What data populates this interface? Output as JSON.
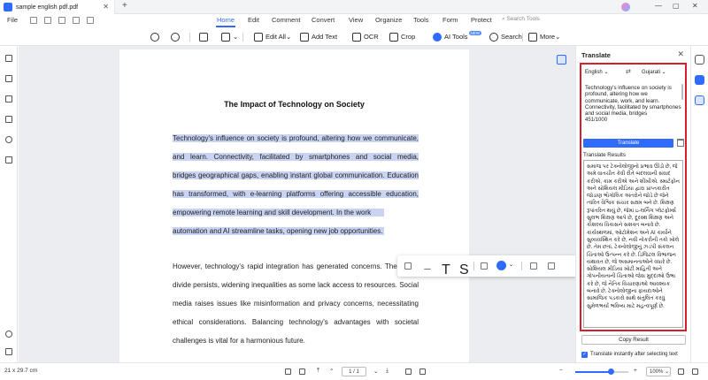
{
  "window": {
    "tab_title": "sample english pdf.pdf",
    "tab_close": "✕",
    "new_tab": "+",
    "minimize": "—",
    "maximize": "▢",
    "close": "✕"
  },
  "menu": {
    "file": "File",
    "items": [
      "Home",
      "Edit",
      "Comment",
      "Convert",
      "View",
      "Organize",
      "Tools",
      "Form",
      "Protect"
    ],
    "active": "Home",
    "search_tools": "Search Tools"
  },
  "toolbar": {
    "edit_all": "Edit All",
    "add_text": "Add Text",
    "ocr": "OCR",
    "crop": "Crop",
    "ai_tools": "AI Tools",
    "ai_badge": "NEW",
    "search": "Search",
    "more": "More"
  },
  "document": {
    "title": "The Impact of Technology on Society",
    "highlighted_lines": [
      "Technology's influence on society is profound, altering how we communicate,",
      "and learn. Connectivity, facilitated by smartphones and social media,",
      "bridges geographical gaps, enabling instant global communication. Education",
      "has transformed, with e-learning platforms offering accessible education,",
      "empowering remote learning and skill development. In the work",
      "automation and AI streamline tasks, opening new job opportunities."
    ],
    "para2_lines": [
      "However, technology's rapid integration has generated concerns. The digital",
      "divide persists, widening inequalities as some lack access to resources. Social",
      "media raises issues like misinformation and privacy concerns, necessitating",
      "ethical considerations. Balancing technology's advantages with societal",
      "challenges is vital for a harmonious future."
    ]
  },
  "translate_panel": {
    "title": "Translate",
    "close": "✕",
    "source_lang": "English",
    "target_lang": "Gujarati",
    "swap": "⇄",
    "source_text": "Technology's influence on society is profound, altering how we communicate, work, and learn. Connectivity, facilitated by smartphones and social media, bridges",
    "char_count": "451/1000",
    "translate_button": "Translate",
    "results_label": "Translate Results",
    "result_text": "સમાજ પર ટેક્નોલોજીનો પ્રભાવ ઊંડો છે, જે અમે વાતચીત કેવી રીતે બદલવાની સંવાદ કરીએ, કામ કરીએ અને શીખીએ. સ્માર્ટફોન અને સોશિયલ મીડિયા દ્વારા પ્રાપ્તકારીત જોડાણ ભૌગોલિક અંતરોને જોડે છે જેને ત્વરિત વૈશ્વિક સંચાર સક્ષમ બને છે. શિક્ષણ રૂપાંતરિત થયું છે, જેમાં ઇ-લર્નિંગ પ્લેટફોર્મ્સ સુલભ શિક્ષણ આપે છે, દૂરસ્થ શિક્ષણ અને કૌશલ્ય વિકાસને સશક્ત બનાવે છે. કાર્યસ્થળમાં, ઓટોમેશન અને AI કાર્યોને સુવ્યવસ્થિત કરે છે, નવી નોકરીની તકો ખોલે છે. તેમ છતાં, ટેક્નોલોજીનું ઝડપી સંકલન ચિંતાઓ ઉત્પન્ન કરે છે. ડિજિટલ વિભાજન યથાવત છે, જે અસમાનતાઓને વધારે છે. સોશિયલ મીડિયા ખોટી માહિતી અને ગોપનીયતાની ચિંતાઓ જેવા મુદ્દાઓ ઉભા કરે છે, જે નૈતિક વિચારણાઓ આવશ્યક બનાવે છે. ટેક્નોલોજીના ફાયદાઓને સામાજિક પડકારો સાથે સંતુલિત કરવું સુમેળભર્યા ભવિષ્ય માટે મહત્વપૂર્ણ છે.",
    "copy_button": "Copy Result",
    "auto_translate_label": "Translate instantly after selecting text"
  },
  "statusbar": {
    "page_size": "21 x 29.7 cm",
    "page_indicator": "1 / 1",
    "zoom": "100%",
    "zoom_level": 0.67
  },
  "colors": {
    "accent": "#2f6bff",
    "highlight": "#c9d3f2",
    "panel_outline": "#d81e2c"
  }
}
